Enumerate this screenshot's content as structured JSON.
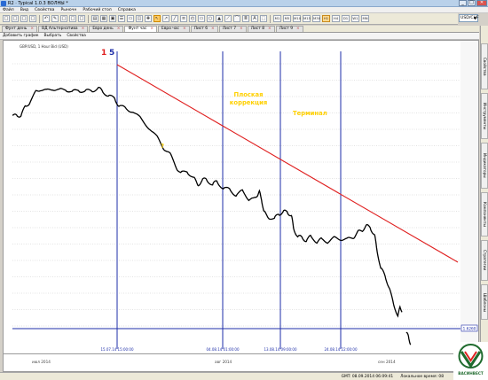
{
  "window": {
    "title": "R2 · Typical 1.0.3 ВОЛНЫ *",
    "buttons": [
      "_",
      "□",
      "✕"
    ]
  },
  "menu": {
    "items": [
      "Файл",
      "Вид",
      "Свойства",
      "Рыночн",
      "Рабочий стол",
      "Справка"
    ]
  },
  "toolbar": {
    "buttons": [
      "□",
      "□",
      "□",
      "□",
      "↶",
      "✎",
      "□",
      "□",
      "□",
      "▤",
      "▦",
      "▣",
      "☰",
      "▭",
      "◫",
      "✚",
      "↖",
      "↗",
      "╱",
      "≡",
      "◴",
      "▭",
      "○",
      "▲",
      "⟋",
      "⌒",
      "Ⅲ",
      "A",
      "⬚"
    ],
    "timeframes": [
      "M1",
      "M5",
      "M10",
      "M15",
      "M30",
      "H1",
      "H4",
      "D1",
      "W1",
      "MN"
    ],
    "symbol": "USD/CHF"
  },
  "tabs": [
    {
      "label": "Фунт день",
      "active": false
    },
    {
      "label": "ВД Альтернатива",
      "active": false
    },
    {
      "label": "Евро день",
      "active": false
    },
    {
      "label": "Фунт час",
      "active": true
    },
    {
      "label": "Евро час",
      "active": false
    },
    {
      "label": "Лист 6",
      "active": false
    },
    {
      "label": "Лист 7",
      "active": false
    },
    {
      "label": "Лист 8",
      "active": false
    },
    {
      "label": "Лист 9",
      "active": false
    }
  ],
  "subtoolbar": {
    "add_chart": "Добавить график",
    "select": "Выбрать",
    "properties": "Свойства"
  },
  "chart": {
    "header": "GBP/USD, 1 Hour Bid (USD)",
    "annotations": {
      "wave_1": "1",
      "wave_5": "5",
      "question": "?",
      "flat": "Плоская\nкоррекция",
      "terminal": "Терминал"
    },
    "price_label": "1.6260",
    "vlines": [
      {
        "label": "15.07.14 15:00:00"
      },
      {
        "label": "04.08.14 01:00:00"
      },
      {
        "label": "13.08.14 09:00:00"
      },
      {
        "label": "24.08.14 22:00:00"
      }
    ],
    "months": [
      "июл 2014",
      "авг 2014",
      "сен 2014"
    ],
    "colors": {
      "price": "#000000",
      "trendline": "#e02020",
      "vlines": "#1e2ea8",
      "hline": "#1e2ea8",
      "annotation": "#ffd000",
      "wave1": "#e02020",
      "wave5": "#1e2ea8"
    }
  },
  "side_tabs": [
    "Свойства",
    "Инструменты",
    "Индикаторы",
    "Компоненты",
    "Стратегии",
    "Шаблоны"
  ],
  "status": {
    "gmt": "GMT: 08.09.2014 06:09:41",
    "local": "Локальное время: 08",
    "logo": "ВАСИНВЕСТ"
  },
  "chart_data": {
    "type": "line",
    "title": "GBP/USD, 1 Hour Bid (USD)",
    "xlabel": "",
    "ylabel": "",
    "x": [
      "июл 2014",
      "авг 2014",
      "сен 2014"
    ],
    "series": [
      {
        "name": "",
        "points": [
          [
            0.0,
            0.168
          ],
          [
            0.01,
            0.172
          ],
          [
            0.02,
            0.165
          ],
          [
            0.03,
            0.14
          ],
          [
            0.04,
            0.12
          ],
          [
            0.055,
            0.085
          ],
          [
            0.065,
            0.072
          ],
          [
            0.08,
            0.08
          ],
          [
            0.095,
            0.07
          ],
          [
            0.11,
            0.078
          ],
          [
            0.125,
            0.072
          ],
          [
            0.14,
            0.085
          ],
          [
            0.155,
            0.075
          ],
          [
            0.17,
            0.082
          ],
          [
            0.185,
            0.078
          ],
          [
            0.2,
            0.07
          ],
          [
            0.21,
            0.078
          ],
          [
            0.225,
            0.095
          ],
          [
            0.24,
            0.11
          ],
          [
            0.25,
            0.13
          ],
          [
            0.265,
            0.145
          ],
          [
            0.28,
            0.15
          ],
          [
            0.3,
            0.18
          ],
          [
            0.32,
            0.21
          ],
          [
            0.34,
            0.25
          ],
          [
            0.355,
            0.285
          ],
          [
            0.37,
            0.31
          ],
          [
            0.385,
            0.355
          ],
          [
            0.395,
            0.38
          ],
          [
            0.41,
            0.37
          ],
          [
            0.425,
            0.395
          ],
          [
            0.435,
            0.42
          ],
          [
            0.445,
            0.405
          ],
          [
            0.455,
            0.4
          ],
          [
            0.47,
            0.418
          ],
          [
            0.48,
            0.41
          ],
          [
            0.495,
            0.43
          ],
          [
            0.51,
            0.44
          ],
          [
            0.525,
            0.455
          ],
          [
            0.54,
            0.445
          ],
          [
            0.555,
            0.47
          ],
          [
            0.565,
            0.475
          ],
          [
            0.575,
            0.455
          ],
          [
            0.58,
            0.448
          ],
          [
            0.585,
            0.47
          ],
          [
            0.59,
            0.52
          ],
          [
            0.6,
            0.535
          ],
          [
            0.615,
            0.545
          ],
          [
            0.625,
            0.525
          ],
          [
            0.635,
            0.52
          ],
          [
            0.645,
            0.518
          ],
          [
            0.655,
            0.53
          ],
          [
            0.66,
            0.58
          ],
          [
            0.67,
            0.605
          ],
          [
            0.68,
            0.615
          ],
          [
            0.69,
            0.62
          ],
          [
            0.7,
            0.61
          ],
          [
            0.715,
            0.625
          ],
          [
            0.725,
            0.62
          ],
          [
            0.74,
            0.625
          ],
          [
            0.755,
            0.615
          ],
          [
            0.77,
            0.615
          ],
          [
            0.785,
            0.62
          ],
          [
            0.8,
            0.61
          ],
          [
            0.81,
            0.595
          ],
          [
            0.82,
            0.585
          ],
          [
            0.83,
            0.57
          ],
          [
            0.84,
            0.575
          ],
          [
            0.85,
            0.6
          ],
          [
            0.855,
            0.65
          ],
          [
            0.865,
            0.72
          ],
          [
            0.875,
            0.755
          ],
          [
            0.885,
            0.79
          ],
          [
            0.895,
            0.86
          ],
          [
            0.905,
            0.89
          ],
          [
            0.91,
            0.87
          ],
          [
            0.915,
            0.875
          ]
        ]
      },
      {
        "name": "",
        "points": [
          [
            0.925,
            0.955
          ],
          [
            0.93,
            0.975
          ],
          [
            0.935,
            0.995
          ]
        ]
      }
    ],
    "grid": true
  }
}
